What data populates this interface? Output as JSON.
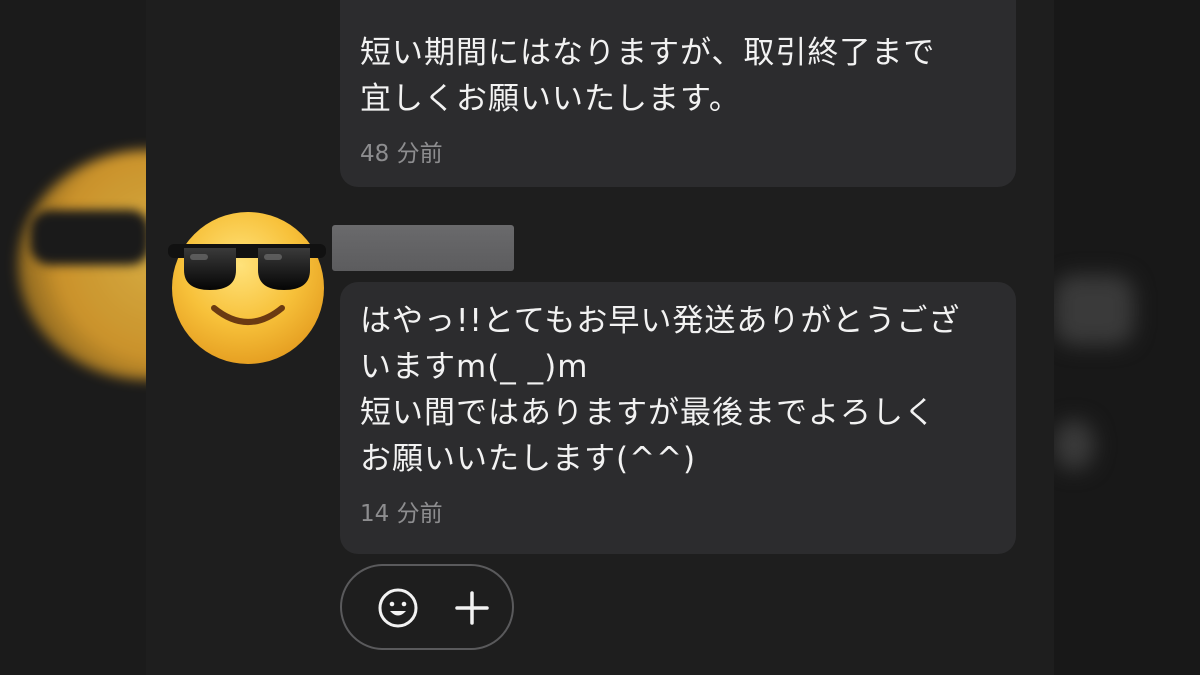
{
  "messages": [
    {
      "lines": [
        "短い期間にはなりますが、取引終了まで",
        "宜しくお願いいたします。"
      ],
      "time": "48 分前"
    },
    {
      "lines": [
        "はやっ!!とてもお早い発送ありがとうござ",
        "いますm(_ _)m",
        "短い間ではありますが最後までよろしく",
        "お願いいたします(^^)"
      ],
      "time": "14 分前"
    }
  ],
  "sender": {
    "avatar_icon": "sunglasses-emoji-icon",
    "name_redacted": true
  },
  "actions": {
    "emoji_icon": "smile-icon",
    "add_icon": "plus-icon"
  },
  "colors": {
    "bubble": "#2c2c2e",
    "text": "#f2f2f2",
    "timestamp": "#8d8d8f"
  }
}
